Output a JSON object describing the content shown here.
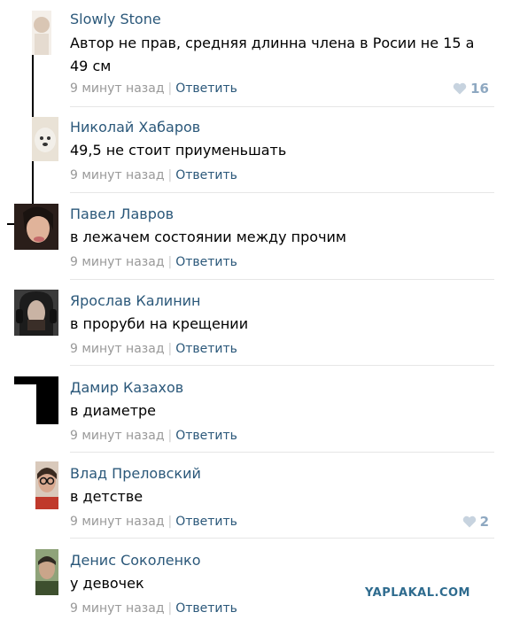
{
  "comments": [
    {
      "author": "Slowly Stone",
      "text": "Автор не прав, средняя длинна члена в Росии не 15 а 49 см",
      "time": "9 минут назад",
      "reply": "Ответить",
      "likes": "16"
    },
    {
      "author": "Николай Хабаров",
      "text": "49,5 не стоит приуменьшать",
      "time": "9 минут назад",
      "reply": "Ответить"
    },
    {
      "author": "Павел Лавров",
      "text": "в лежачем состоянии между прочим",
      "time": "9 минут назад",
      "reply": "Ответить"
    },
    {
      "author": "Ярослав Калинин",
      "text": "в проруби на крещении",
      "time": "9 минут назад",
      "reply": "Ответить"
    },
    {
      "author": "Дамир Казахов",
      "text": "в диаметре",
      "time": "9 минут назад",
      "reply": "Ответить"
    },
    {
      "author": "Влад Преловский",
      "text": "в детстве",
      "time": "9 минут назад",
      "reply": "Ответить",
      "likes": "2"
    },
    {
      "author": "Денис Соколенко",
      "text": "у девочек",
      "time": "9 минут назад",
      "reply": "Ответить"
    }
  ],
  "watermark": "YAPLAKAL.COM",
  "colors": {
    "author": "#2b587a",
    "meta": "#999999",
    "like": "#8ea8c1"
  }
}
